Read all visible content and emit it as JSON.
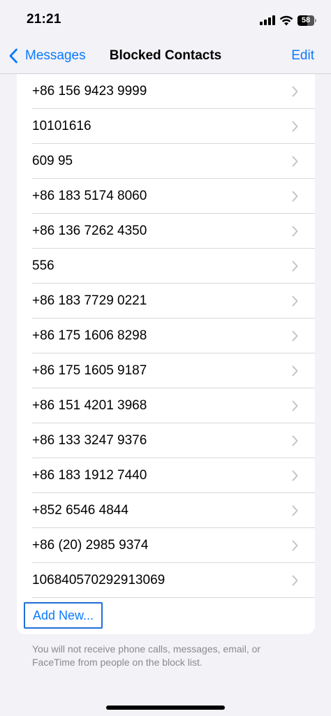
{
  "status_bar": {
    "time": "21:21",
    "battery_level": "58",
    "battery_fraction": 0.58
  },
  "nav": {
    "back_label": "Messages",
    "title": "Blocked Contacts",
    "edit_label": "Edit"
  },
  "blocked_list": [
    {
      "label": "+86 156 9423 9999"
    },
    {
      "label": "10101616"
    },
    {
      "label": "609 95"
    },
    {
      "label": "+86 183 5174 8060"
    },
    {
      "label": "+86 136 7262 4350"
    },
    {
      "label": "556"
    },
    {
      "label": "+86 183 7729 0221"
    },
    {
      "label": "+86 175 1606 8298"
    },
    {
      "label": "+86 175 1605 9187"
    },
    {
      "label": "+86 151 4201 3968"
    },
    {
      "label": "+86 133 3247 9376"
    },
    {
      "label": "+86 183 1912 7440"
    },
    {
      "label": "+852 6546 4844"
    },
    {
      "label": "+86 (20) 2985 9374"
    },
    {
      "label": "106840570292913069"
    }
  ],
  "add_new_label": "Add New...",
  "footer_note": "You will not receive phone calls, messages, email, or FaceTime from people on the block list.",
  "colors": {
    "accent": "#0a7aff",
    "background": "#f2f2f7",
    "card": "#ffffff",
    "separator": "#d8d8dc",
    "secondary_text": "#8a8a8e"
  },
  "icons": {
    "back": "chevron-left-icon",
    "row": "chevron-right-icon",
    "signal": "cellular-signal-icon",
    "wifi": "wifi-icon",
    "battery": "battery-icon"
  }
}
